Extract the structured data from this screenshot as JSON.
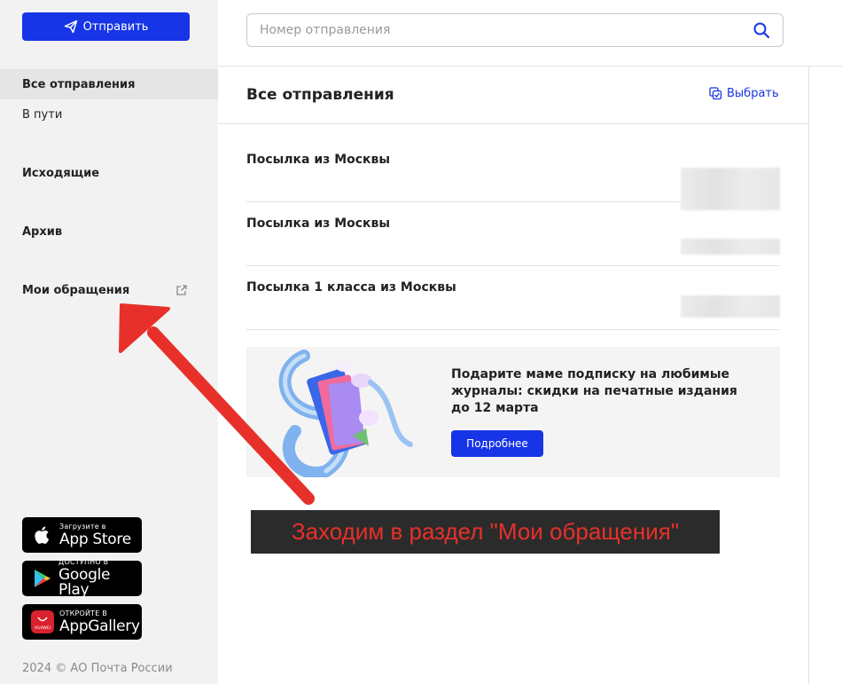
{
  "sidebar": {
    "send_label": "Отправить",
    "items": [
      {
        "label": "Все отправления"
      },
      {
        "label": "В пути"
      },
      {
        "label": "Исходящие"
      },
      {
        "label": "Архив"
      },
      {
        "label": "Мои обращения"
      }
    ],
    "stores": [
      {
        "small": "Загрузите в",
        "big": "App Store",
        "icon": "apple-icon"
      },
      {
        "small": "ДОСТУПНО В",
        "big": "Google Play",
        "icon": "google-play-icon"
      },
      {
        "small": "ОТКРОЙТЕ В",
        "big": "AppGallery",
        "icon": "huawei-icon",
        "icon_text": "HUAWEI"
      }
    ],
    "copyright": "2024 © АО Почта России"
  },
  "search": {
    "placeholder": "Номер отправления"
  },
  "main": {
    "title": "Все отправления",
    "select_label": "Выбрать",
    "parcels": [
      {
        "title": "Посылка из Москвы"
      },
      {
        "title": "Посылка из Москвы"
      },
      {
        "title": "Посылка 1 класса из Москвы"
      }
    ]
  },
  "banner": {
    "text": "Подарите маме подписку на любимые журналы: скидки на печатные издания до 12 марта",
    "button_label": "Подробнее"
  },
  "annotation": {
    "text": "Заходим в раздел \"Мои обращения\""
  },
  "colors": {
    "accent": "#1735e6",
    "annotation_text": "#e8302a",
    "arrow": "#e8302a",
    "sidebar_bg": "#f3f2f2"
  }
}
